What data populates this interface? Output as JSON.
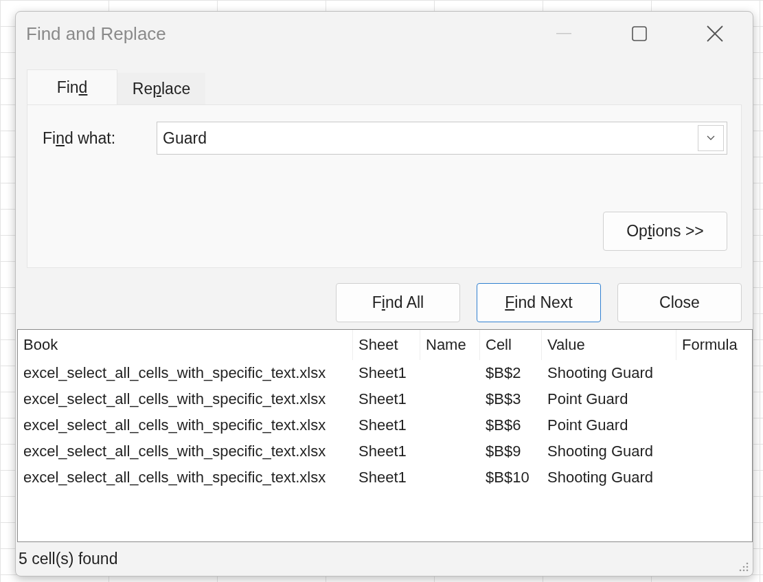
{
  "window": {
    "title": "Find and Replace",
    "minimize_disabled": true
  },
  "tabs": [
    {
      "pre": "Fin",
      "key": "d",
      "selected": true
    },
    {
      "pre": "Re",
      "key": "p",
      "post": "lace",
      "selected": false
    }
  ],
  "find_field": {
    "pre": "Fi",
    "key": "n",
    "post": "d what:",
    "value": "Guard"
  },
  "options_button": {
    "pre": "Op",
    "key": "t",
    "post": "ions >>"
  },
  "buttons": [
    {
      "pre": "F",
      "key": "i",
      "post": "nd All",
      "focused": false
    },
    {
      "key": "F",
      "post": "ind Next",
      "focused": true
    },
    {
      "pre": "Close",
      "focused": false
    }
  ],
  "results": {
    "columns": [
      "Book",
      "Sheet",
      "Name",
      "Cell",
      "Value",
      "Formula"
    ],
    "rows": [
      [
        "excel_select_all_cells_with_specific_text.xlsx",
        "Sheet1",
        "",
        "$B$2",
        "Shooting Guard",
        ""
      ],
      [
        "excel_select_all_cells_with_specific_text.xlsx",
        "Sheet1",
        "",
        "$B$3",
        "Point Guard",
        ""
      ],
      [
        "excel_select_all_cells_with_specific_text.xlsx",
        "Sheet1",
        "",
        "$B$6",
        "Point Guard",
        ""
      ],
      [
        "excel_select_all_cells_with_specific_text.xlsx",
        "Sheet1",
        "",
        "$B$9",
        "Shooting Guard",
        ""
      ],
      [
        "excel_select_all_cells_with_specific_text.xlsx",
        "Sheet1",
        "",
        "$B$10",
        "Shooting Guard",
        ""
      ]
    ]
  },
  "status_bar": "5 cell(s) found"
}
